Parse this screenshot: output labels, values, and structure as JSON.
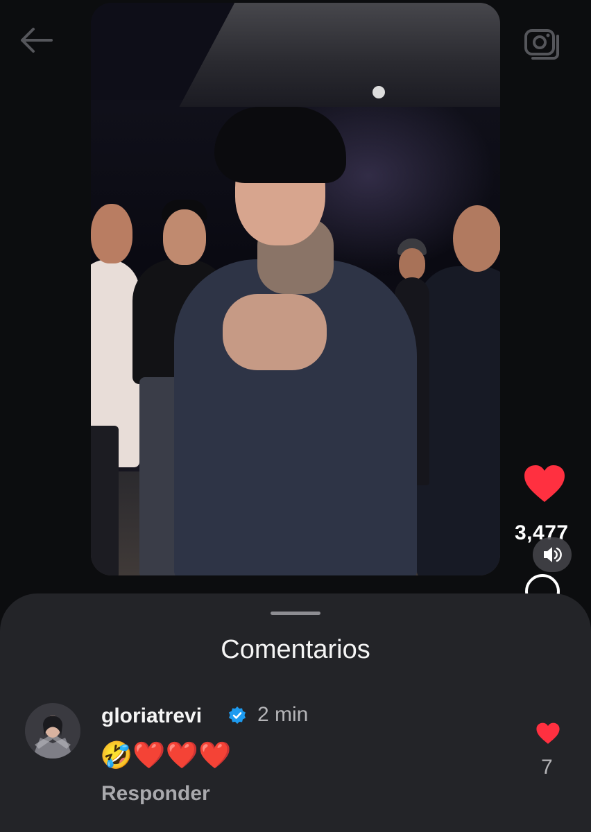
{
  "header": {
    "back_icon": "arrow-left-icon",
    "camera_icon": "camera-icon"
  },
  "video": {
    "description_icon": "video-frame",
    "likes": "3,477",
    "like_icon": "heart-filled-icon",
    "sound_icon": "speaker-icon",
    "comment_icon": "comment-circle-icon"
  },
  "comments": {
    "title": "Comentarios",
    "items": [
      {
        "username": "gloriatrevi",
        "verified": true,
        "time": "2 min",
        "text": "🤣❤️❤️❤️",
        "reply_label": "Responder",
        "likes": "7"
      }
    ]
  },
  "colors": {
    "like_red": "#ff3040",
    "verified_blue": "#1d9bf0",
    "sheet_bg": "#232428",
    "page_bg": "#0c0d0f"
  }
}
